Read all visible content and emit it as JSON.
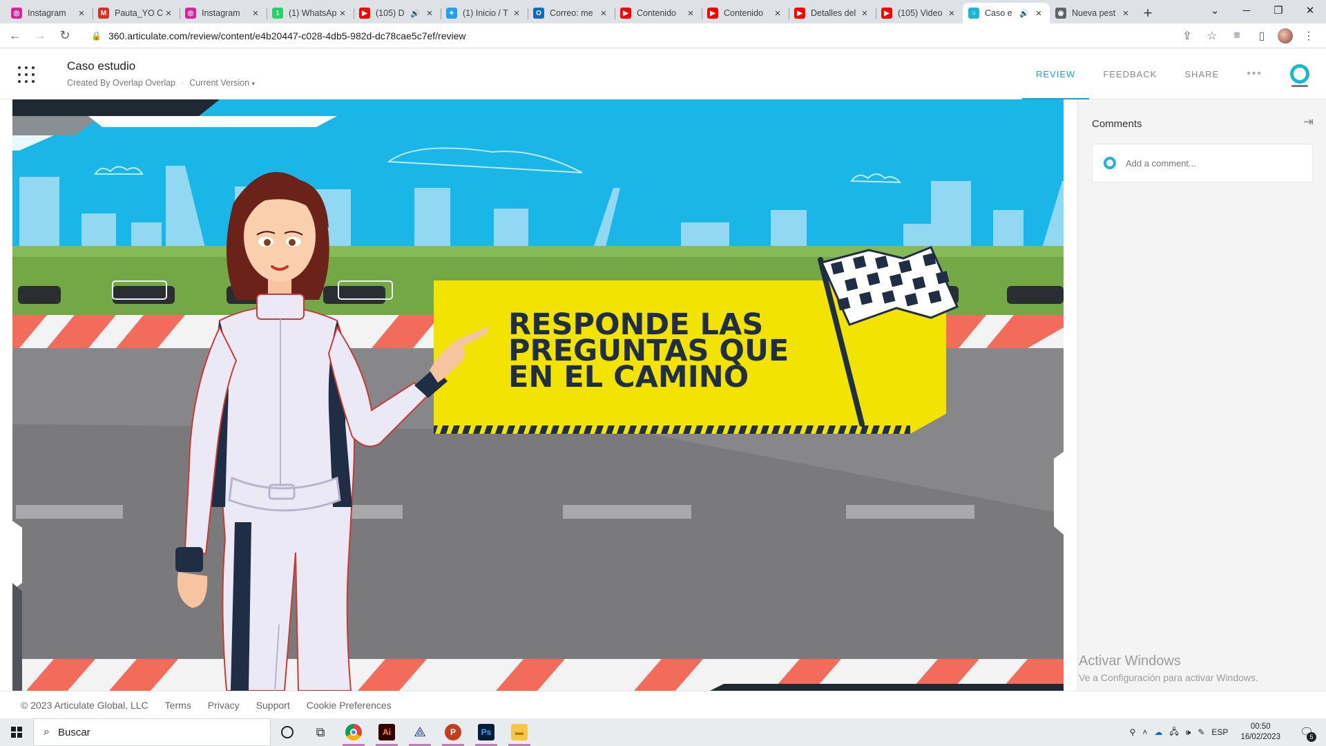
{
  "browser": {
    "tabs": [
      {
        "title": "Instagram",
        "icon": "instagram-icon",
        "color": "#d6249f",
        "glyph": "◎"
      },
      {
        "title": "Pauta_YO C",
        "icon": "gmail-icon",
        "color": "#d93025",
        "glyph": "M"
      },
      {
        "title": "Instagram",
        "icon": "instagram-icon",
        "color": "#d6249f",
        "glyph": "◎"
      },
      {
        "title": "(1) WhatsAp",
        "icon": "whatsapp-icon",
        "color": "#25d366",
        "glyph": "1"
      },
      {
        "title": "(105) D",
        "icon": "youtube-icon",
        "color": "#ff0000",
        "glyph": "▶",
        "audio": true
      },
      {
        "title": "(1) Inicio / T",
        "icon": "twitter-icon",
        "color": "#1da1f2",
        "glyph": "✦"
      },
      {
        "title": "Correo: me",
        "icon": "outlook-icon",
        "color": "#0f6cbd",
        "glyph": "O"
      },
      {
        "title": "Contenido",
        "icon": "youtube-icon",
        "color": "#ff0000",
        "glyph": "▶"
      },
      {
        "title": "Contenido",
        "icon": "youtube-icon",
        "color": "#ff0000",
        "glyph": "▶"
      },
      {
        "title": "Detalles del",
        "icon": "youtube-icon",
        "color": "#ff0000",
        "glyph": "▶"
      },
      {
        "title": "(105) Video",
        "icon": "youtube-icon",
        "color": "#ff0000",
        "glyph": "▶"
      },
      {
        "title": "Caso e",
        "icon": "articulate-icon",
        "color": "#1bb6d6",
        "glyph": "○",
        "audio": true,
        "active": true
      },
      {
        "title": "Nueva pest",
        "icon": "chrome-icon",
        "color": "#5f6368",
        "glyph": "◉"
      }
    ],
    "url": "360.articulate.com/review/content/e4b20447-c028-4db5-982d-dc78cae5c7ef/review"
  },
  "app": {
    "title": "Caso estudio",
    "created_by": "Created By Overlap Overlap",
    "separator": "·",
    "version": "Current Version",
    "nav": {
      "review": "REVIEW",
      "feedback": "FEEDBACK",
      "share": "SHARE",
      "more": "•••"
    },
    "accent_color": "#1aa0d4"
  },
  "slide": {
    "banner_line1": "RESPONDE LAS",
    "banner_line2": "PREGUNTAS QUE",
    "banner_line3": "EN EL CAMINO"
  },
  "comments": {
    "title": "Comments",
    "placeholder": "Add a comment..."
  },
  "watermark": {
    "line1": "Activar Windows",
    "line2": "Ve a Configuración para activar Windows."
  },
  "footer": {
    "copyright": "© 2023 Articulate Global, LLC",
    "links": [
      "Terms",
      "Privacy",
      "Support",
      "Cookie Preferences"
    ]
  },
  "taskbar": {
    "search_placeholder": "Buscar",
    "lang": "ESP",
    "time": "00:50",
    "date": "16/02/2023",
    "notifications": "5"
  }
}
